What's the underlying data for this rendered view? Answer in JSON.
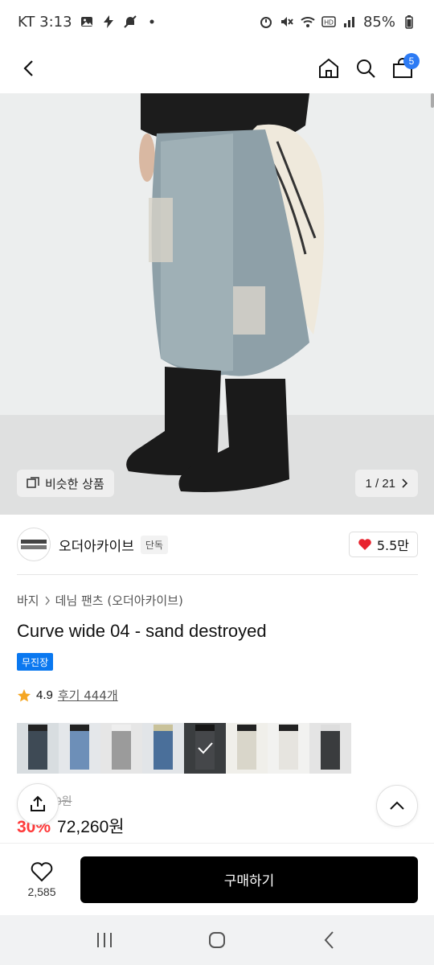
{
  "status_bar": {
    "carrier_time": "KT 3:13",
    "battery": "85%",
    "icons": [
      "gallery-icon",
      "lightning-icon",
      "bell-off-icon",
      "dot-icon",
      "alarm-icon",
      "mute-icon",
      "wifi-icon",
      "hd-icon",
      "signal-icon",
      "battery-icon"
    ]
  },
  "nav": {
    "back_icon": "chevron-left-icon",
    "home_icon": "home-icon",
    "search_icon": "search-icon",
    "cart_icon": "bag-icon",
    "cart_count": "5",
    "accent_color": "#2d7bf4"
  },
  "hero": {
    "similar_label": "비슷한 상품",
    "page_indicator": "1 / 21"
  },
  "brand": {
    "name": "오더아카이브",
    "tag": "단독",
    "like_count": "5.5만",
    "heart_color": "#e8232e"
  },
  "breadcrumb": [
    "바지",
    "데님 팬츠 (오더아카이브)"
  ],
  "product": {
    "title": "Curve wide 04 - sand destroyed",
    "badge": "무진장",
    "badge_color": "#0a78f0"
  },
  "rating": {
    "value": "4.9",
    "review_text": "후기 444개",
    "star_color": "#f5a623"
  },
  "thumbnails": [
    {
      "name": "thumb-1",
      "color": "#3e4a55"
    },
    {
      "name": "thumb-2",
      "color": "#6d8fb8"
    },
    {
      "name": "thumb-3",
      "color": "#9b9b9b"
    },
    {
      "name": "thumb-4",
      "color": "#4a6f9a"
    },
    {
      "name": "thumb-5",
      "color": "#6a6e72",
      "selected": true
    },
    {
      "name": "thumb-6",
      "color": "#d9d6ca"
    },
    {
      "name": "thumb-7",
      "color": "#e6e4df"
    },
    {
      "name": "thumb-8",
      "color": "#3a3c3e"
    }
  ],
  "price": {
    "original": "00원",
    "discount": "30%",
    "final": "72,260원",
    "discount_color": "#ff3a3a"
  },
  "bottom_bar": {
    "wish_count": "2,585",
    "buy_label": "구매하기"
  },
  "system_nav": [
    "recent-apps-icon",
    "home-button-icon",
    "back-icon"
  ]
}
